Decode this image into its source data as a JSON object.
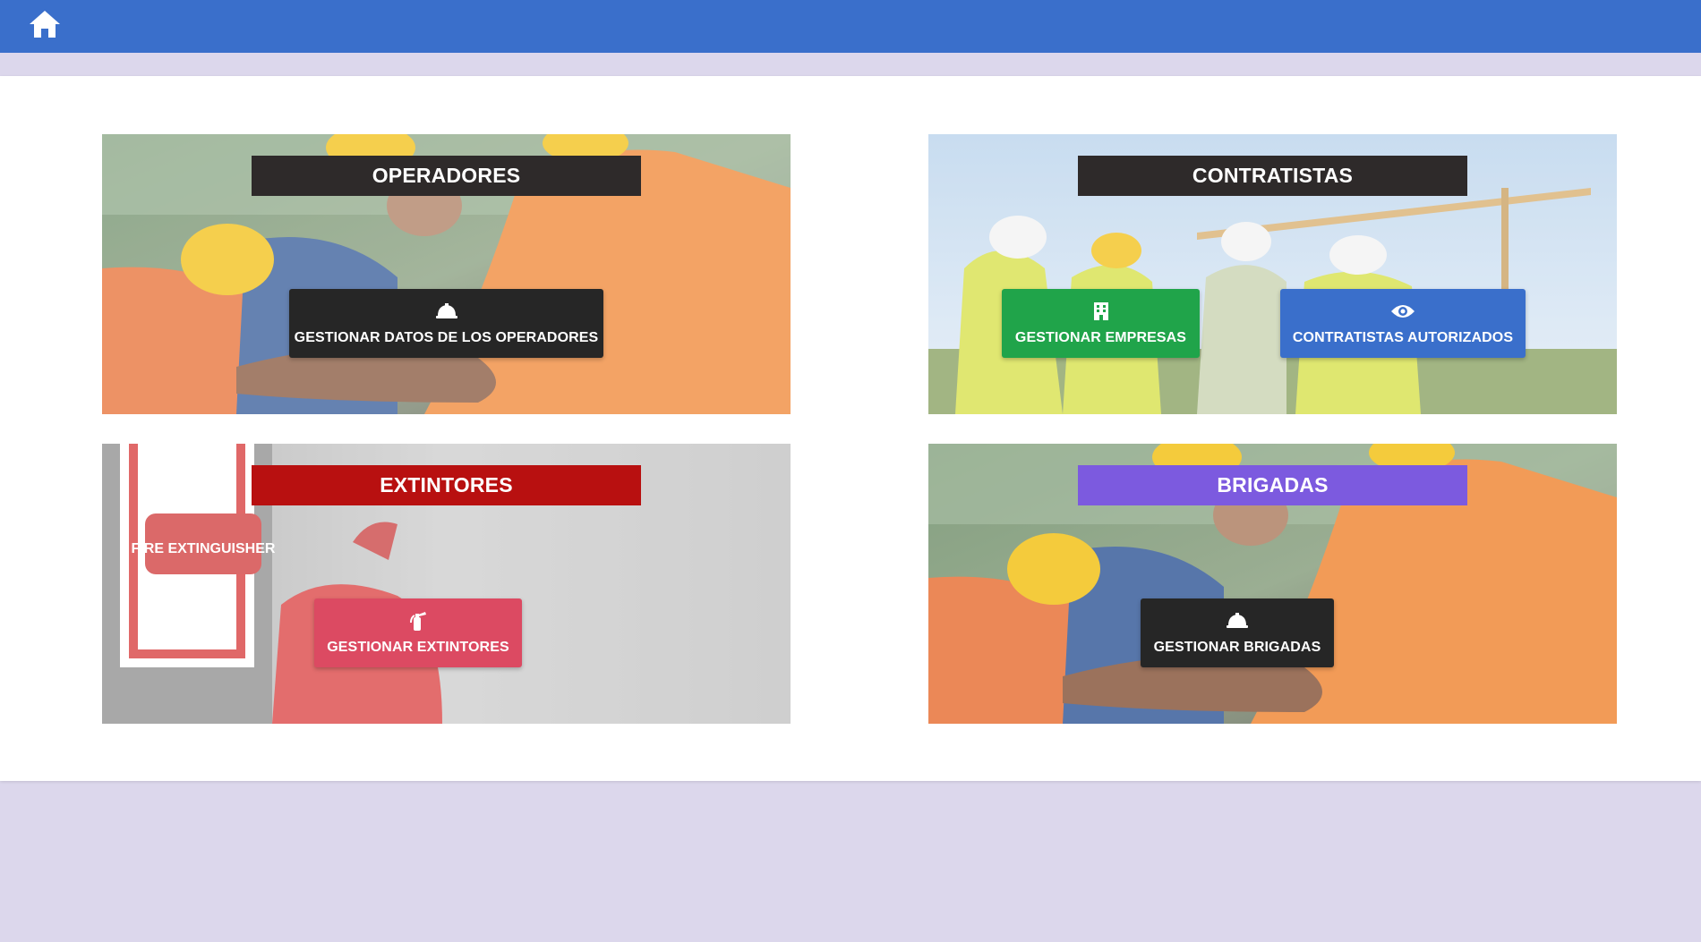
{
  "colors": {
    "topbar": "#3a6fcb",
    "page_background": "#dcd7ec",
    "title_dark": "#2e2a2a",
    "title_red": "#b81010",
    "title_purple": "#7c5adf",
    "button_dark": "#262626",
    "button_green": "#20a44a",
    "button_blue": "#3a6fcb",
    "button_pink": "#dc4a62"
  },
  "topbar": {
    "home_icon": "home-icon"
  },
  "cards": [
    {
      "title": "OPERADORES",
      "image": "workers-hands-together-photo",
      "actions": [
        {
          "label": "GESTIONAR DATOS DE LOS OPERADORES",
          "icon": "hard-hat-icon"
        }
      ]
    },
    {
      "title": "CONTRATISTAS",
      "image": "construction-site-workers-photo",
      "actions": [
        {
          "label": "GESTIONAR EMPRESAS",
          "icon": "building-icon"
        },
        {
          "label": "CONTRATISTAS AUTORIZADOS",
          "icon": "eye-icon"
        }
      ]
    },
    {
      "title": "EXTINTORES",
      "image": "fire-extinguisher-photo",
      "image_text": "FIRE EXTINGUISHER",
      "actions": [
        {
          "label": "GESTIONAR EXTINTORES",
          "icon": "fire-extinguisher-icon"
        }
      ]
    },
    {
      "title": "BRIGADAS",
      "image": "workers-hands-together-photo",
      "actions": [
        {
          "label": "GESTIONAR BRIGADAS",
          "icon": "hard-hat-icon"
        }
      ]
    }
  ]
}
